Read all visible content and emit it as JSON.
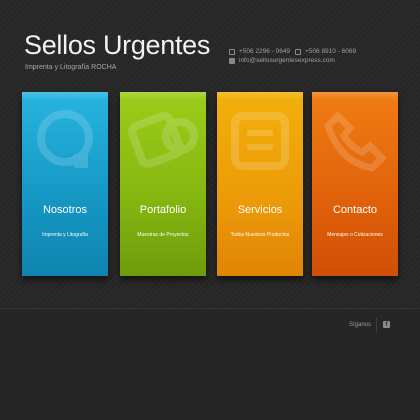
{
  "header": {
    "title": "Sellos Urgentes",
    "subtitle": "Imprenta y Litografía ROCHA",
    "phone1": "+506 2296 - 0649",
    "phone2": "+506 8910 - 6069",
    "email": "info@sellosurgentesexpress.com"
  },
  "cards": [
    {
      "title": "Nosotros",
      "subtitle": "Imprenta y Litografía",
      "color": "#1a9fcc",
      "icon": "chat-icon"
    },
    {
      "title": "Portafolio",
      "subtitle": "Muestras de Proyectos",
      "color": "#8bbd12",
      "icon": "stamp-icon"
    },
    {
      "title": "Servicios",
      "subtitle": "Todos Nuestros Productos",
      "color": "#eea108",
      "icon": "list-icon"
    },
    {
      "title": "Contacto",
      "subtitle": "Mensajes o Cotizaciones",
      "color": "#e5670b",
      "icon": "phone-icon"
    }
  ],
  "footer": {
    "follow_label": "Síganos",
    "facebook_glyph": "f"
  }
}
